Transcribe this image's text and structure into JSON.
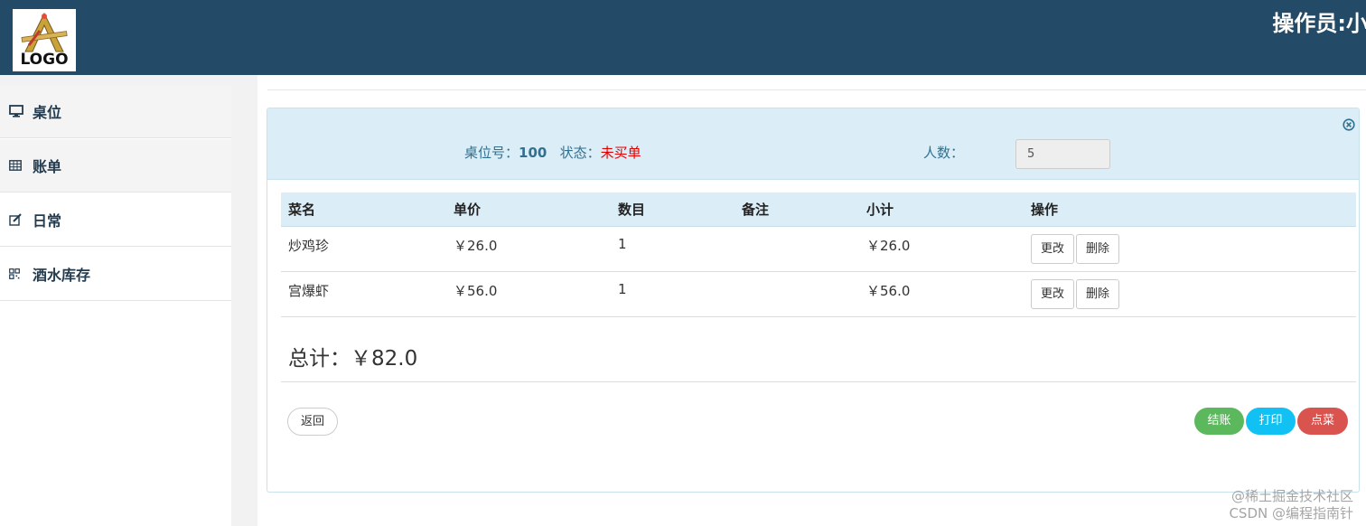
{
  "header": {
    "logo_text": "LOGO",
    "operator": "操作员:小"
  },
  "sidebar": {
    "items": [
      {
        "label": "桌位",
        "icon": "monitor-icon"
      },
      {
        "label": "账单",
        "icon": "table-grid-icon"
      },
      {
        "label": "日常",
        "icon": "edit-icon"
      },
      {
        "label": "酒水库存",
        "icon": "qrcode-icon"
      }
    ]
  },
  "panel": {
    "table_label": "桌位号：",
    "table_number": "100",
    "status_label": "状态：",
    "status_value": "未买单",
    "people_label": "人数：",
    "people_value": "5",
    "columns": [
      "菜名",
      "单价",
      "数目",
      "备注",
      "小计",
      "操作"
    ],
    "rows": [
      {
        "name": "炒鸡珍",
        "price": "￥26.0",
        "qty": "1",
        "note": "",
        "subtotal": "￥26.0"
      },
      {
        "name": "宫爆虾",
        "price": "￥56.0",
        "qty": "1",
        "note": "",
        "subtotal": "￥56.0"
      }
    ],
    "edit_label": "更改",
    "delete_label": "删除",
    "total_label": "总计：",
    "total_value": "￥82.0",
    "back_label": "返回",
    "checkout_label": "结账",
    "print_label": "打印",
    "order_label": "点菜"
  },
  "watermark": {
    "line1": "@稀土掘金技术社区",
    "line2": "CSDN @编程指南针"
  },
  "colors": {
    "header_bg": "#234a66",
    "panel_head_bg": "#dbedf7",
    "status_red": "#e00000",
    "checkout_green": "#5cb85c",
    "print_cyan": "#11c1f3",
    "order_red": "#d9534f"
  }
}
